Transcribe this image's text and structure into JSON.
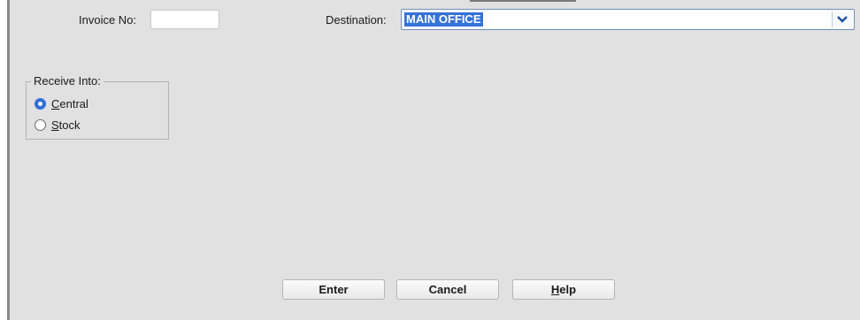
{
  "form": {
    "invoice_label": "Invoice No:",
    "invoice_value": "",
    "destination_label": "Destination:",
    "destination_value": "MAIN OFFICE"
  },
  "receive_into": {
    "legend": "Receive Into:",
    "options": [
      {
        "mnemonic": "C",
        "rest": "entral",
        "checked": true
      },
      {
        "mnemonic": "S",
        "rest": "tock",
        "checked": false
      }
    ]
  },
  "buttons": {
    "enter_label": "Enter",
    "cancel_label": "Cancel",
    "help_mnemonic": "H",
    "help_rest": "elp"
  },
  "icons": {
    "dropdown": "chevron-down-icon"
  },
  "colors": {
    "panel_bg": "#e1e1e1",
    "selection": "#3573d6",
    "accent": "#2f6fd6"
  }
}
